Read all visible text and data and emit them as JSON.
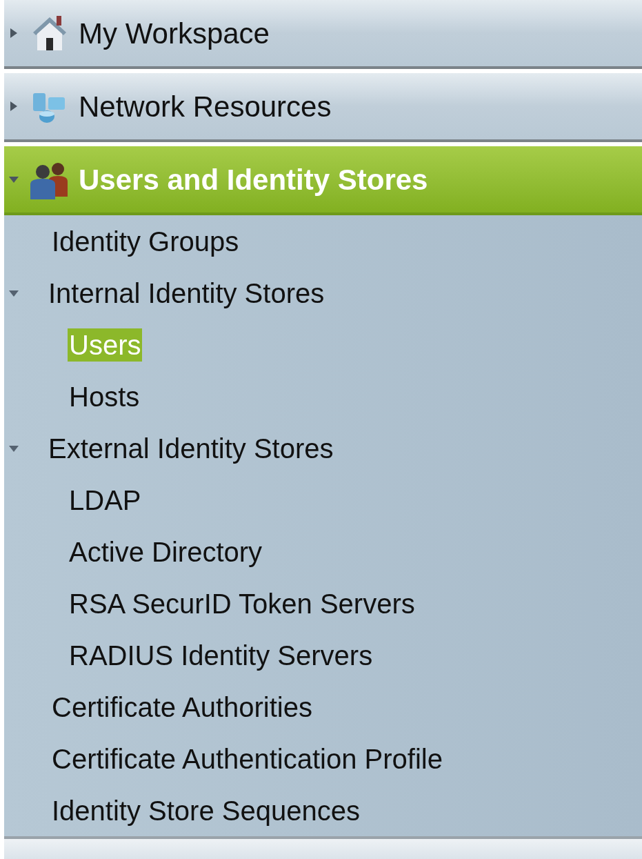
{
  "sections": [
    {
      "label": "My Workspace",
      "expanded": false,
      "selected": false
    },
    {
      "label": "Network Resources",
      "expanded": false,
      "selected": false
    },
    {
      "label": "Users and Identity Stores",
      "expanded": true,
      "selected": true,
      "items": [
        {
          "label": "Identity Groups",
          "selected": false
        },
        {
          "label": "Internal Identity Stores",
          "selected": false,
          "expanded": true,
          "children": [
            {
              "label": "Users",
              "selected": true
            },
            {
              "label": "Hosts",
              "selected": false
            }
          ]
        },
        {
          "label": "External Identity Stores",
          "selected": false,
          "expanded": true,
          "children": [
            {
              "label": "LDAP",
              "selected": false
            },
            {
              "label": "Active Directory",
              "selected": false
            },
            {
              "label": "RSA SecurID Token Servers",
              "selected": false
            },
            {
              "label": "RADIUS Identity Servers",
              "selected": false
            }
          ]
        },
        {
          "label": "Certificate Authorities",
          "selected": false
        },
        {
          "label": "Certificate Authentication Profile",
          "selected": false
        },
        {
          "label": "Identity Store Sequences",
          "selected": false
        }
      ]
    }
  ]
}
